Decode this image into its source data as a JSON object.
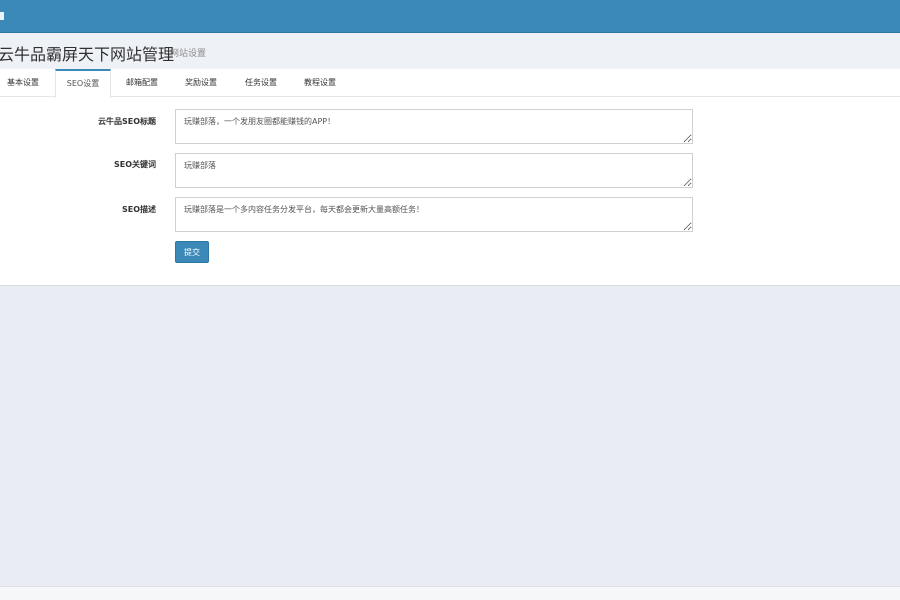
{
  "header": {
    "title": "云牛品霸屏天下网站管理",
    "subtitle": "网站设置"
  },
  "tabs": [
    {
      "label": "基本设置",
      "active": false
    },
    {
      "label": "SEO设置",
      "active": true
    },
    {
      "label": "邮箱配置",
      "active": false
    },
    {
      "label": "奖励设置",
      "active": false
    },
    {
      "label": "任务设置",
      "active": false
    },
    {
      "label": "教程设置",
      "active": false
    }
  ],
  "form": {
    "seo_title": {
      "label": "云牛品SEO标题",
      "value": "玩赚部落，一个发朋友圈都能赚钱的APP！"
    },
    "seo_keywords": {
      "label": "SEO关键词",
      "value": "玩赚部落"
    },
    "seo_description": {
      "label": "SEO描述",
      "value": "玩赚部落是一个多内容任务分发平台，每天都会更新大量高额任务！"
    },
    "submit_label": "提交"
  },
  "colors": {
    "brand": "#3a89b9",
    "background": "#e9edf3"
  }
}
